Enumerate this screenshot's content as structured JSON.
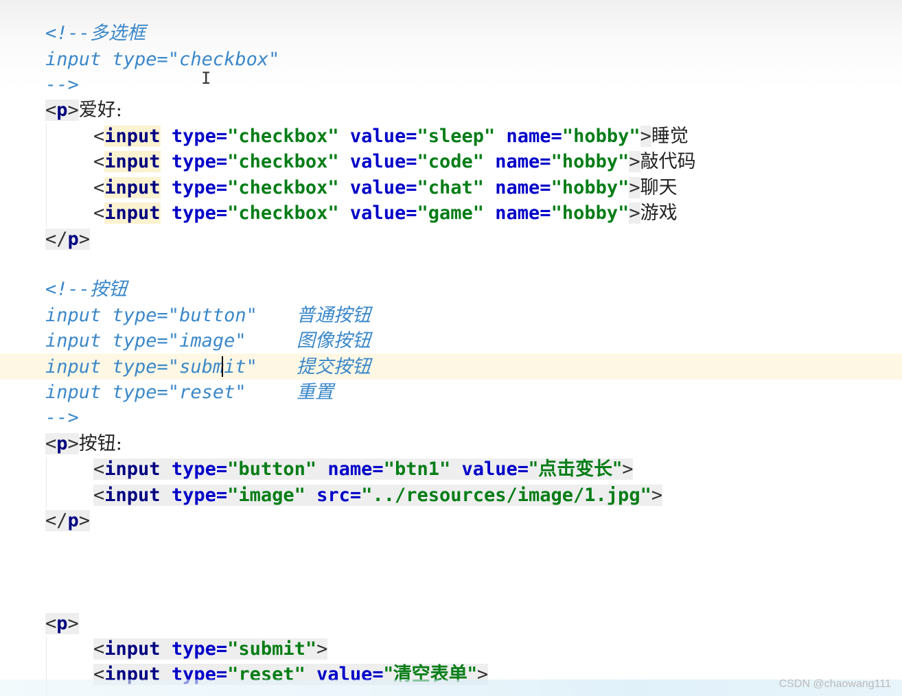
{
  "editor": {
    "lines": {
      "l1": "<!--多选框",
      "l2": "input type=\"checkbox\"",
      "l3": "-->",
      "l4_text": "爱好:",
      "cb": [
        {
          "value": "\"sleep\"",
          "name": "\"hobby\"",
          "label": "睡觉"
        },
        {
          "value": "\"code\"",
          "name": "\"hobby\"",
          "label": "敲代码"
        },
        {
          "value": "\"chat\"",
          "name": "\"hobby\"",
          "label": "聊天"
        },
        {
          "value": "\"game\"",
          "name": "\"hobby\"",
          "label": "游戏"
        }
      ],
      "l10_comment": "<!--按钮",
      "btn_comments": [
        {
          "code": "input type=\"button\"",
          "desc": "普通按钮"
        },
        {
          "code": "input type=\"image\"",
          "desc": "图像按钮"
        },
        {
          "code": "input type=\"submit\"",
          "desc": "提交按钮"
        },
        {
          "code": "input type=\"reset\"",
          "desc": "重置"
        }
      ],
      "l15": "-->",
      "l16_text": "按钮:",
      "btn1_type": "\"button\"",
      "btn1_name": "\"btn1\"",
      "btn1_value": "\"点击变长\"",
      "img_type": "\"image\"",
      "img_src": "\"../resources/image/1.jpg\"",
      "submit_type": "\"submit\"",
      "reset_type": "\"reset\"",
      "reset_value": "\"清空表单\""
    },
    "tokens": {
      "input": "input",
      "type": "type=",
      "value": "value=",
      "name": "name=",
      "src": "src=",
      "checkbox": "\"checkbox\"",
      "p": "p"
    },
    "highlight_line": "input type=\"submit\"",
    "watermark": "CSDN @chaowang111"
  }
}
